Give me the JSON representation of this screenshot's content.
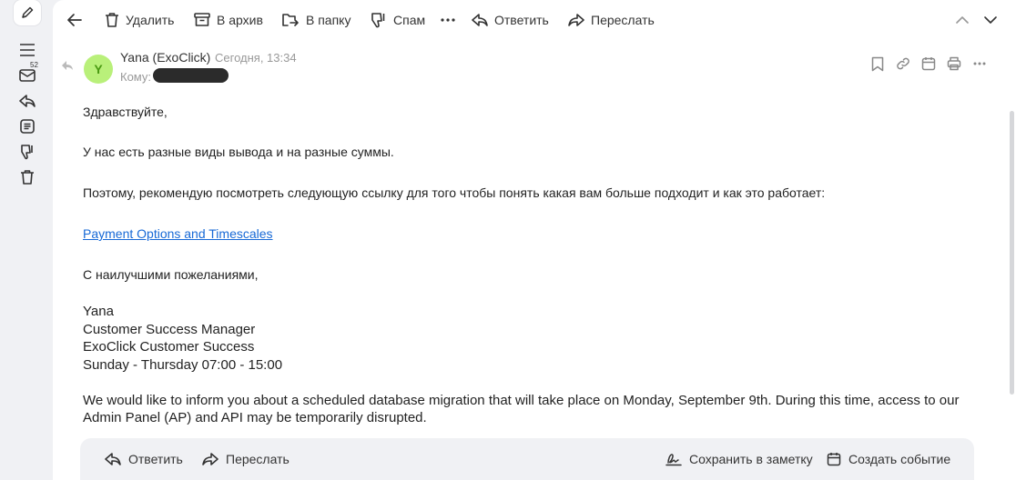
{
  "rail": {
    "unread_count": "52"
  },
  "toolbar": {
    "delete": "Удалить",
    "archive": "В архив",
    "to_folder": "В папку",
    "spam": "Спам",
    "reply": "Ответить",
    "forward": "Переслать"
  },
  "message": {
    "avatar_letter": "Y",
    "sender": "Yana (ExoClick)",
    "date": "Сегодня, 13:34",
    "to_label": "Кому:",
    "body": {
      "greeting": "Здравствуйте,",
      "line1": "У нас есть разные виды вывода и на разные суммы.",
      "line2": "Поэтому, рекомендую посмотреть следующую ссылку для того чтобы понять какая вам больше подходит и как это работает:",
      "link": "Payment Options and Timescales",
      "regards": "С наилучшими пожеланиями,",
      "sig_name": "Yana",
      "sig_title": "Customer Success Manager",
      "sig_team": "ExoClick Customer Success",
      "sig_hours": "Sunday - Thursday 07:00 - 15:00",
      "notice1": "We would like to inform you about a scheduled database migration that will take place on Monday, September 9th. During this time, access to our",
      "notice2": "Admin Panel (AP) and API may be temporarily disrupted."
    }
  },
  "reply_bar": {
    "reply": "Ответить",
    "forward": "Переслать",
    "save_note": "Сохранить в заметку",
    "create_event": "Создать событие"
  }
}
